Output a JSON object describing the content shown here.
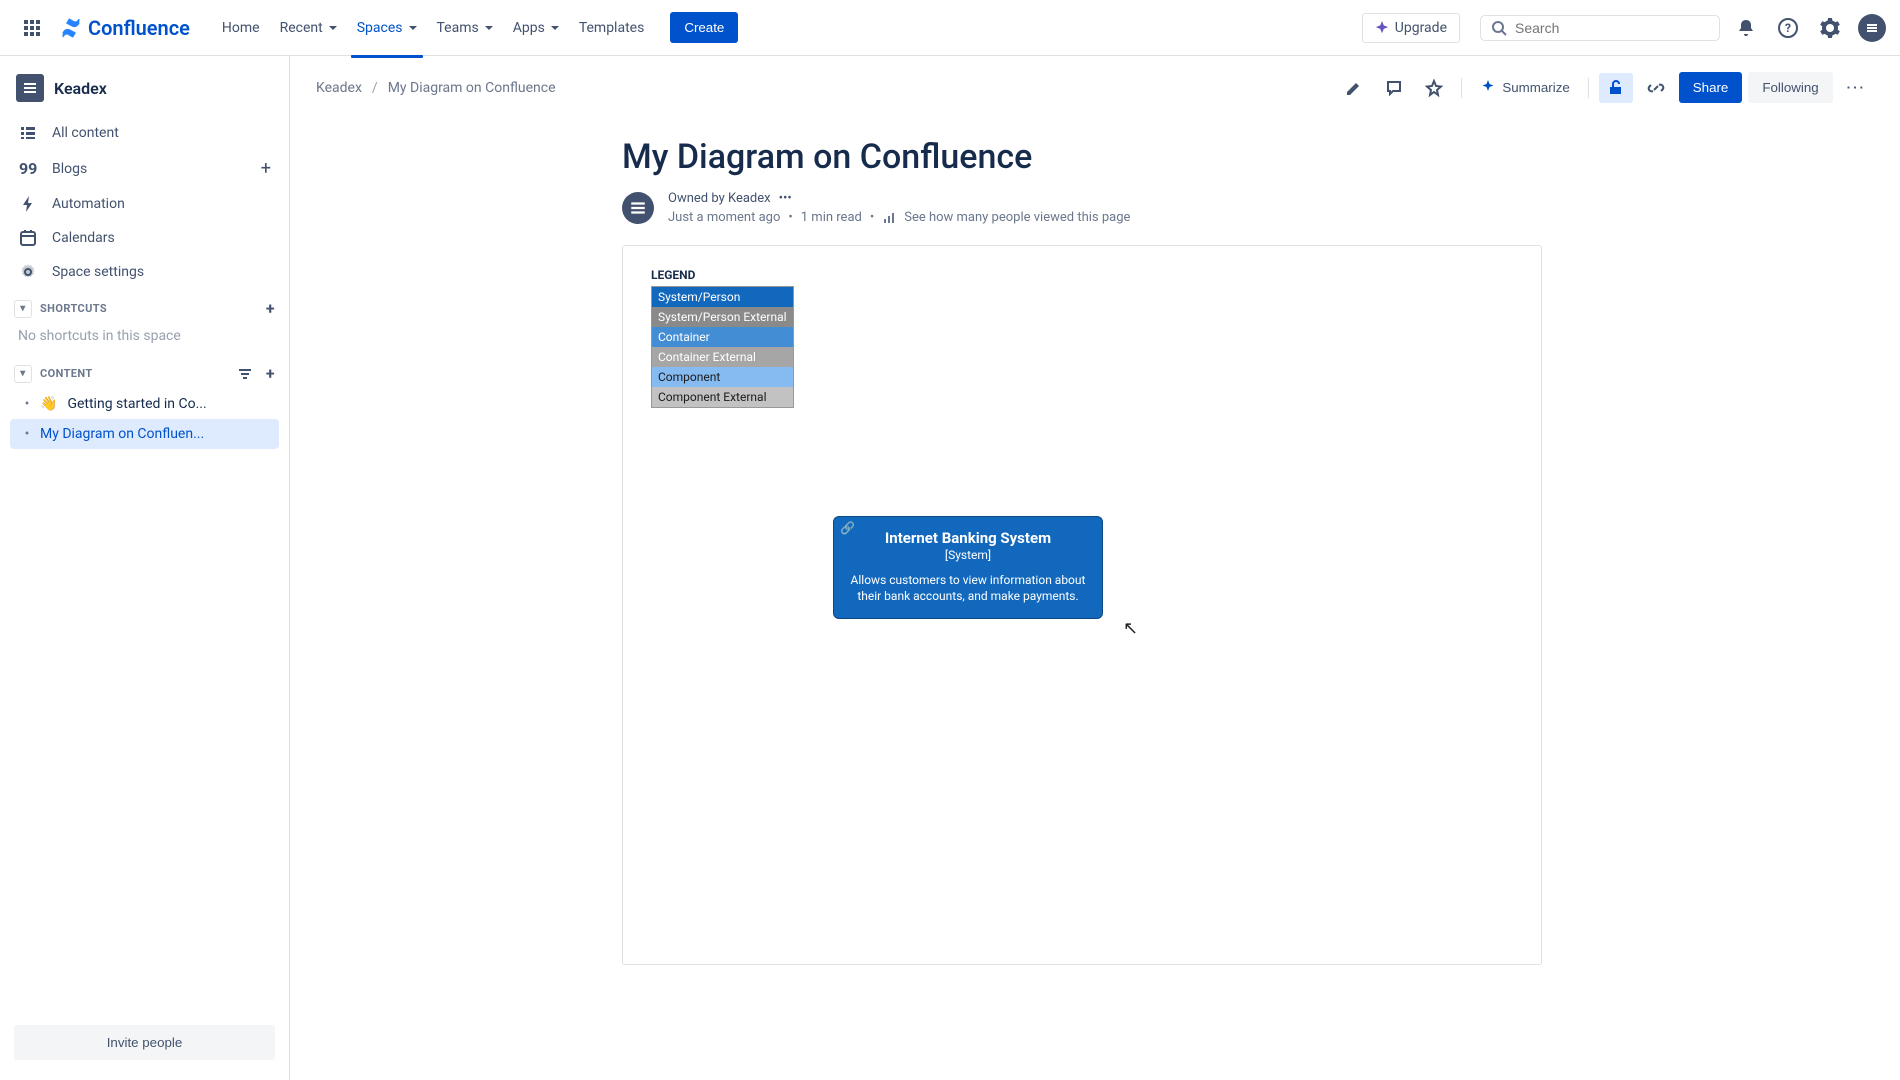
{
  "header": {
    "product": "Confluence",
    "nav": {
      "home": "Home",
      "recent": "Recent",
      "spaces": "Spaces",
      "teams": "Teams",
      "apps": "Apps",
      "templates": "Templates"
    },
    "create": "Create",
    "upgrade": "Upgrade",
    "search_placeholder": "Search"
  },
  "sidebar": {
    "space_name": "Keadex",
    "items": {
      "all_content": "All content",
      "blogs": "Blogs",
      "automation": "Automation",
      "calendars": "Calendars",
      "space_settings": "Space settings"
    },
    "shortcuts_label": "SHORTCUTS",
    "shortcuts_empty": "No shortcuts in this space",
    "content_label": "CONTENT",
    "tree": {
      "getting_started": "Getting started in Co...",
      "my_diagram": "My Diagram on Confluen..."
    },
    "invite": "Invite people"
  },
  "page": {
    "breadcrumb_space": "Keadex",
    "breadcrumb_page": "My Diagram on Confluence",
    "summarize": "Summarize",
    "share": "Share",
    "following": "Following",
    "title": "My Diagram on Confluence",
    "owned_by": "Owned by Keadex",
    "timestamp": "Just a moment ago",
    "read_time": "1 min read",
    "views_prompt": "See how many people viewed this page"
  },
  "diagram": {
    "legend_title": "LEGEND",
    "legend": {
      "system_person": "System/Person",
      "system_person_ext": "System/Person External",
      "container": "Container",
      "container_ext": "Container External",
      "component": "Component",
      "component_ext": "Component External"
    },
    "box": {
      "title": "Internet Banking System",
      "stereotype": "[System]",
      "description": "Allows customers to view information about their bank accounts, and make payments."
    }
  }
}
